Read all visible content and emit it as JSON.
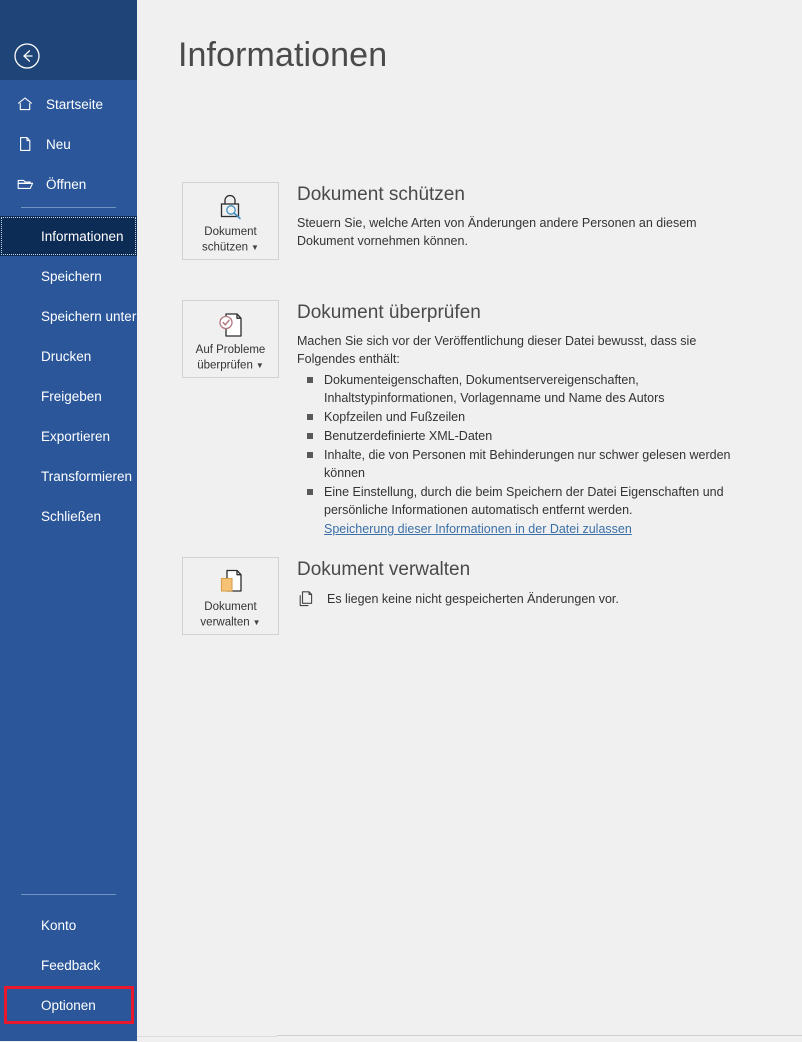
{
  "app": {
    "title": "Informationen"
  },
  "sidebar": {
    "back_icon": "back-arrow-icon",
    "top_items": [
      {
        "label": "Startseite",
        "icon": "home-icon"
      },
      {
        "label": "Neu",
        "icon": "new-document-icon"
      },
      {
        "label": "Öffnen",
        "icon": "open-folder-icon"
      }
    ],
    "mid_items": [
      {
        "label": "Informationen",
        "selected": true
      },
      {
        "label": "Speichern",
        "selected": false
      },
      {
        "label": "Speichern unter",
        "selected": false
      },
      {
        "label": "Drucken",
        "selected": false
      },
      {
        "label": "Freigeben",
        "selected": false
      },
      {
        "label": "Exportieren",
        "selected": false
      },
      {
        "label": "Transformieren",
        "selected": false
      },
      {
        "label": "Schließen",
        "selected": false
      }
    ],
    "bottom_items": [
      {
        "label": "Konto",
        "selected": false
      },
      {
        "label": "Feedback",
        "selected": false
      },
      {
        "label": "Optionen",
        "selected": false,
        "highlighted": true
      }
    ]
  },
  "annotations": {
    "highlight_color": "#e8192c",
    "arrow_color": "#e8192c",
    "arrow_direction": "left",
    "arrow_target": "Optionen"
  },
  "main": {
    "sections": [
      {
        "button_label_line1": "Dokument",
        "button_label_line2": "schützen",
        "button_icon": "lock-inspect-icon",
        "heading": "Dokument schützen",
        "description": "Steuern Sie, welche Arten von Änderungen andere Personen an diesem Dokument vornehmen können."
      },
      {
        "button_label_line1": "Auf Probleme",
        "button_label_line2": "überprüfen",
        "button_icon": "document-check-icon",
        "heading": "Dokument überprüfen",
        "description": "Machen Sie sich vor der Veröffentlichung dieser Datei bewusst, dass sie Folgendes enthält:",
        "bullets": [
          "Dokumenteigenschaften, Dokumentservereigenschaften, Inhaltstypinformationen, Vorlagenname und Name des Autors",
          "Kopfzeilen und Fußzeilen",
          "Benutzerdefinierte XML-Daten",
          "Inhalte, die von Personen mit Behinderungen nur schwer gelesen werden können",
          "Eine Einstellung, durch die beim Speichern der Datei Eigenschaften und persönliche Informationen automatisch entfernt werden."
        ],
        "link": "Speicherung dieser Informationen in der Datei zulassen"
      },
      {
        "button_label_line1": "Dokument",
        "button_label_line2": "verwalten",
        "button_icon": "document-versions-icon",
        "heading": "Dokument verwalten",
        "status_icon": "document-copy-icon",
        "status_text": "Es liegen keine nicht gespeicherten Änderungen vor."
      }
    ]
  },
  "colors": {
    "sidebar_blue": "#2b579a",
    "sidebar_dark": "#1f4477",
    "selected_navy": "#0d2c55",
    "content_bg": "#f0f0f0",
    "link_blue": "#3b6fa8",
    "accent_red": "#e8192c"
  }
}
